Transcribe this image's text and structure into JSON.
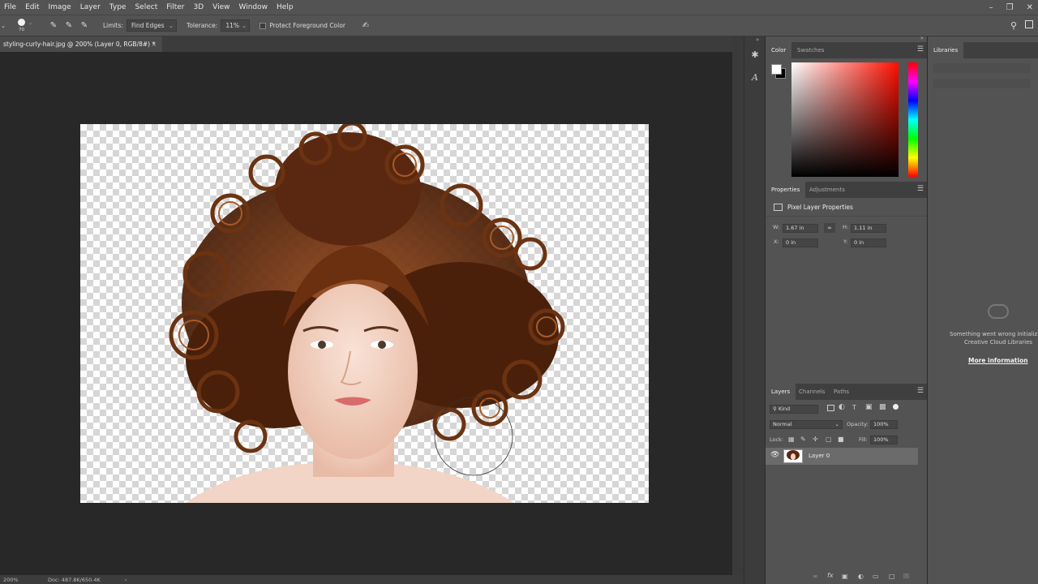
{
  "menubar": {
    "items": [
      "File",
      "Edit",
      "Image",
      "Layer",
      "Type",
      "Select",
      "Filter",
      "3D",
      "View",
      "Window",
      "Help"
    ]
  },
  "options": {
    "brush_size": "70",
    "limits_label": "Limits:",
    "limits_value": "Find Edges",
    "tolerance_label": "Tolerance:",
    "tolerance_value": "11%",
    "protect_fg_label": "Protect Foreground Color"
  },
  "document": {
    "tab_title": "styling-curly-hair.jpg @ 200% (Layer 0, RGB/8#) *",
    "close_label": "×"
  },
  "status": {
    "zoom": "200%",
    "doc_size": "Doc: 487.8K/650.4K"
  },
  "color_panel": {
    "tabs": [
      "Color",
      "Swatches"
    ]
  },
  "properties_panel": {
    "tabs": [
      "Properties",
      "Adjustments"
    ],
    "header": "Pixel Layer Properties",
    "w_label": "W:",
    "w_value": "1.67 in",
    "h_label": "H:",
    "h_value": "1.11 in",
    "x_label": "X:",
    "x_value": "0 in",
    "y_label": "Y:",
    "y_value": "0 in"
  },
  "layers_panel": {
    "tabs": [
      "Layers",
      "Channels",
      "Paths"
    ],
    "filter_kind": "Kind",
    "blend_mode": "Normal",
    "opacity_label": "Opacity:",
    "opacity_value": "100%",
    "lock_label": "Lock:",
    "fill_label": "Fill:",
    "fill_value": "100%",
    "layers": [
      {
        "name": "Layer 0"
      }
    ]
  },
  "libraries_panel": {
    "tab": "Libraries",
    "error_line1": "Something went wrong initializing",
    "error_line2": "Creative Cloud Libraries",
    "more_info": "More information"
  },
  "colors": {
    "ui_dark": "#282828",
    "ui_panel": "#535353",
    "selected_layer": "#6b6b6b"
  }
}
